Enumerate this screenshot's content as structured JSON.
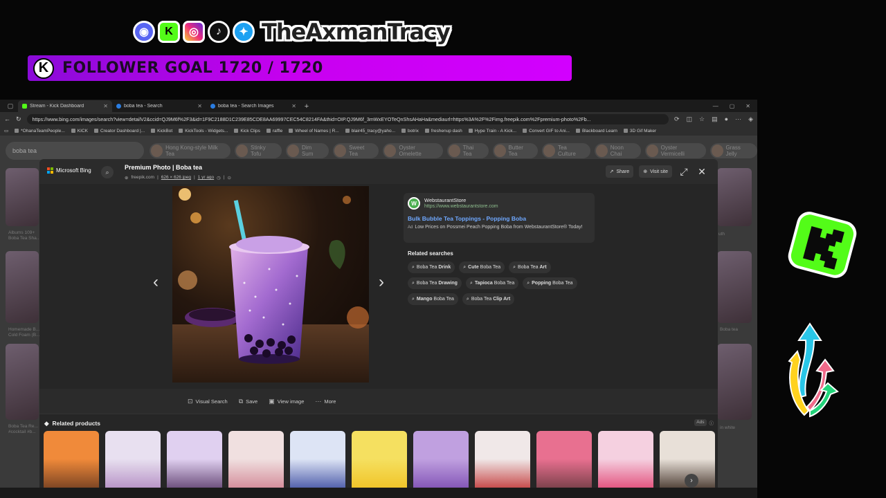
{
  "overlay": {
    "social_icons": [
      "discord-icon",
      "kick-icon",
      "instagram-icon",
      "tiktok-icon",
      "twitter-icon"
    ],
    "handle": "TheAxmanTracy",
    "goal_badge": "K",
    "goal_text": "FOLLOWER GOAL 1720 / 1720",
    "goal_color": "#c800f0"
  },
  "browser": {
    "tabs": [
      {
        "label": "Stream - Kick Dashboard",
        "active": true
      },
      {
        "label": "boba tea - Search",
        "active": false
      },
      {
        "label": "boba tea - Search Images",
        "active": false
      }
    ],
    "url": "https://www.bing.com/images/search?view=detailV2&ccid=QJ9M6f%2F3&id=1F9C2188D1C239E85CDE8AA69997CEC54C8214FA&thid=OIP.QJ9M6f_3mWxEYOTeQnShsAHaHa&mediaurl=https%3A%2F%2Fimg.freepik.com%2Fpremium-photo%2Fb...",
    "bookmarks": [
      "*OhanaTeamPeople...",
      "KICK",
      "Creator Dashboard |...",
      "KickBot",
      "KickTools - Widgets...",
      "Kick Clips",
      "raffle",
      "Wheel of Names | R...",
      "blair45_tracy@yaho...",
      "botrix",
      "freshenup dash",
      "Hype Train - A Kick...",
      "Convert GIF to Ani...",
      "Blackboard Learn",
      "3D Gif Maker"
    ]
  },
  "bing_bg": {
    "search_value": "boba tea",
    "chips": [
      "Hong Kong-style Milk Tea",
      "Stinky Tofu",
      "Dim Sum",
      "Sweet Tea",
      "Oyster Omelette",
      "Thai Tea",
      "Butter Tea",
      "Tea Culture",
      "Noon Chai",
      "Oyster Vermicelli",
      "Grass Jelly"
    ],
    "captions": [
      "Albums 109+ Boba Tea Sha...",
      "Homemade B... Cold Foam (B...",
      "Boba Tea Re... #cocktail #b...",
      "uth",
      "Boba tea",
      "in white"
    ]
  },
  "modal": {
    "brand": "Microsoft Bing",
    "title": "Premium Photo | Boba tea",
    "source": "freepik.com",
    "size": "626 × 626 jpeg",
    "age": "1 yr ago",
    "share_label": "Share",
    "visit_label": "Visit site",
    "ad": {
      "name": "WebstaurantStore",
      "url": "https://www.webstaurantstore.com",
      "headline": "Bulk Bubble Tea Toppings - Popping Boba",
      "tag": "Ad",
      "description": "Low Prices on Possmei Peach Popping Boba from WebstaurantStore® Today!"
    },
    "related_title": "Related searches",
    "related": [
      {
        "pre": "Boba Tea ",
        "bold": "Drink",
        "post": ""
      },
      {
        "pre": "",
        "bold": "Cute",
        "post": " Boba Tea"
      },
      {
        "pre": "Boba Tea ",
        "bold": "Art",
        "post": ""
      },
      {
        "pre": "Boba Tea ",
        "bold": "Drawing",
        "post": ""
      },
      {
        "pre": "",
        "bold": "Tapioca",
        "post": " Boba Tea"
      },
      {
        "pre": "",
        "bold": "Popping",
        "post": " Boba Tea"
      },
      {
        "pre": "",
        "bold": "Mango",
        "post": " Boba Tea"
      },
      {
        "pre": "Boba Tea ",
        "bold": "Clip Art",
        "post": ""
      }
    ],
    "actions": [
      {
        "label": "Visual Search",
        "icon": "visual-search-icon",
        "glyph": "⊡"
      },
      {
        "label": "Save",
        "icon": "save-icon",
        "glyph": "⧉"
      },
      {
        "label": "View image",
        "icon": "view-image-icon",
        "glyph": "▣"
      },
      {
        "label": "More",
        "icon": "more-icon",
        "glyph": "···"
      }
    ],
    "products_title": "Related products",
    "products_ads": "Ads",
    "product_count": 11
  }
}
